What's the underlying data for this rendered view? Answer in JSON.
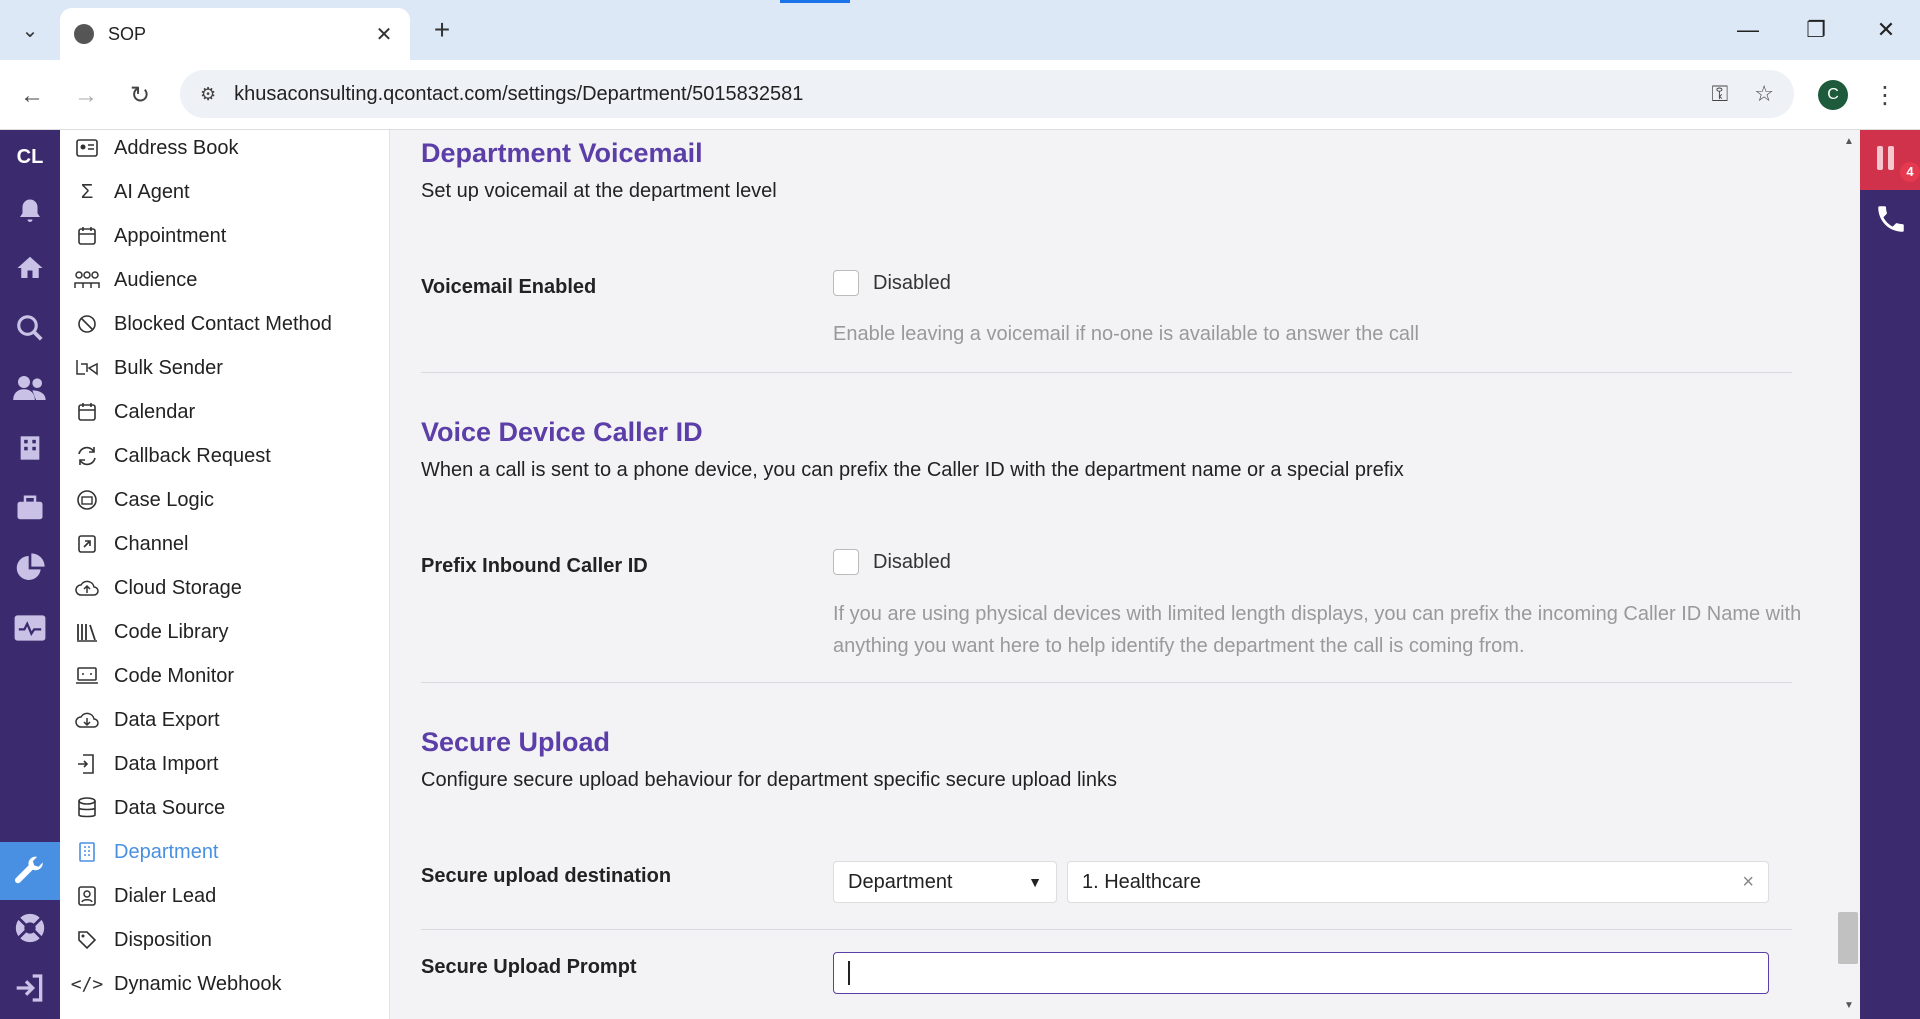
{
  "browser": {
    "tab_title": "SOP",
    "url": "khusaconsulting.qcontact.com/settings/Department/5015832581",
    "profile_initial": "C"
  },
  "app": {
    "logo": "CL",
    "notification_count": "4"
  },
  "sidebar": {
    "items": [
      {
        "label": "Address Book",
        "icon": "address-book-icon"
      },
      {
        "label": "AI Agent",
        "icon": "sigma-icon"
      },
      {
        "label": "Appointment",
        "icon": "calendar-icon"
      },
      {
        "label": "Audience",
        "icon": "group-icon"
      },
      {
        "label": "Blocked Contact Method",
        "icon": "block-icon"
      },
      {
        "label": "Bulk Sender",
        "icon": "bulk-sender-icon"
      },
      {
        "label": "Calendar",
        "icon": "calendar-icon"
      },
      {
        "label": "Callback Request",
        "icon": "callback-icon"
      },
      {
        "label": "Case Logic",
        "icon": "case-logic-icon"
      },
      {
        "label": "Channel",
        "icon": "channel-icon"
      },
      {
        "label": "Cloud Storage",
        "icon": "cloud-upload-icon"
      },
      {
        "label": "Code Library",
        "icon": "library-icon"
      },
      {
        "label": "Code Monitor",
        "icon": "monitor-icon"
      },
      {
        "label": "Data Export",
        "icon": "download-icon"
      },
      {
        "label": "Data Import",
        "icon": "import-icon"
      },
      {
        "label": "Data Source",
        "icon": "database-icon"
      },
      {
        "label": "Department",
        "icon": "department-icon",
        "active": true
      },
      {
        "label": "Dialer Lead",
        "icon": "dialer-lead-icon"
      },
      {
        "label": "Disposition",
        "icon": "tag-icon"
      },
      {
        "label": "Dynamic Webhook",
        "icon": "code-icon"
      }
    ]
  },
  "sections": {
    "voicemail": {
      "title": "Department Voicemail",
      "description": "Set up voicemail at the department level",
      "field_label": "Voicemail Enabled",
      "checkbox_label": "Disabled",
      "help": "Enable leaving a voicemail if no-one is available to answer the call"
    },
    "caller_id": {
      "title": "Voice Device Caller ID",
      "description": "When a call is sent to a phone device, you can prefix the Caller ID with the department name or a special prefix",
      "field_label": "Prefix Inbound Caller ID",
      "checkbox_label": "Disabled",
      "help": "If you are using physical devices with limited length displays, you can prefix the incoming Caller ID Name with anything you want here to help identify the department the call is coming from."
    },
    "secure_upload": {
      "title": "Secure Upload",
      "description": "Configure secure upload behaviour for department specific secure upload links",
      "destination_label": "Secure upload destination",
      "destination_type": "Department",
      "destination_value": "1. Healthcare",
      "prompt_label": "Secure Upload Prompt",
      "prompt_value": ""
    }
  },
  "colors": {
    "rail": "#3b2a6e",
    "accent": "#5b3ea8",
    "active_blue": "#4a90e2",
    "alert_red": "#d0314b"
  }
}
